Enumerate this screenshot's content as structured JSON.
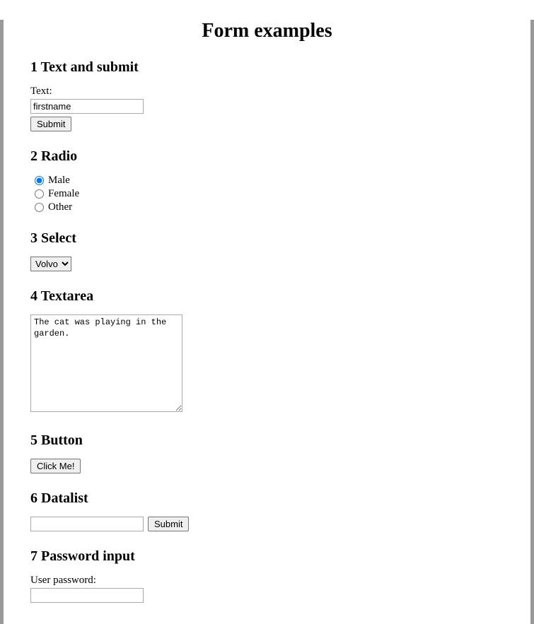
{
  "title": "Form examples",
  "sections": {
    "s1": {
      "heading": "1 Text and submit",
      "text_label": "Text:",
      "text_value": "firstname",
      "submit_label": "Submit"
    },
    "s2": {
      "heading": "2 Radio",
      "options": {
        "male": "Male",
        "female": "Female",
        "other": "Other"
      },
      "selected": "male"
    },
    "s3": {
      "heading": "3 Select",
      "selected_label": "Volvo"
    },
    "s4": {
      "heading": "4 Textarea",
      "value": "The cat was playing in the garden."
    },
    "s5": {
      "heading": "5 Button",
      "button_label": "Click Me!"
    },
    "s6": {
      "heading": "6 Datalist",
      "input_value": "",
      "submit_label": "Submit"
    },
    "s7": {
      "heading": "7 Password input",
      "label": "User password:",
      "value": ""
    }
  }
}
